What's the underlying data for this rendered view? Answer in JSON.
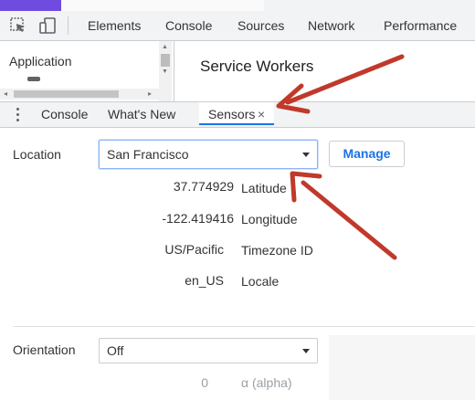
{
  "toolbar": {
    "tabs": [
      "Elements",
      "Console",
      "Sources",
      "Network",
      "Performance"
    ],
    "icons": [
      "select-element-icon",
      "device-toggle-icon"
    ]
  },
  "application": {
    "sidebar_label": "Application",
    "main_title": "Service Workers"
  },
  "drawer": {
    "tabs": [
      "Console",
      "What's New",
      "Sensors"
    ],
    "active_tab": "Sensors",
    "close_glyph": "×"
  },
  "sensors": {
    "location": {
      "label": "Location",
      "selected": "San Francisco",
      "manage_label": "Manage",
      "fields": [
        {
          "value": "37.774929",
          "label": "Latitude"
        },
        {
          "value": "-122.419416",
          "label": "Longitude"
        },
        {
          "value": "US/Pacific",
          "label": "Timezone ID"
        },
        {
          "value": "en_US",
          "label": "Locale"
        }
      ]
    },
    "orientation": {
      "label": "Orientation",
      "selected": "Off",
      "alpha_value": "0",
      "alpha_label": "α (alpha)"
    }
  },
  "colors": {
    "accent": "#1a73e8",
    "annotation_arrow": "#c0392b",
    "purple_strip": "#6f4be0"
  }
}
